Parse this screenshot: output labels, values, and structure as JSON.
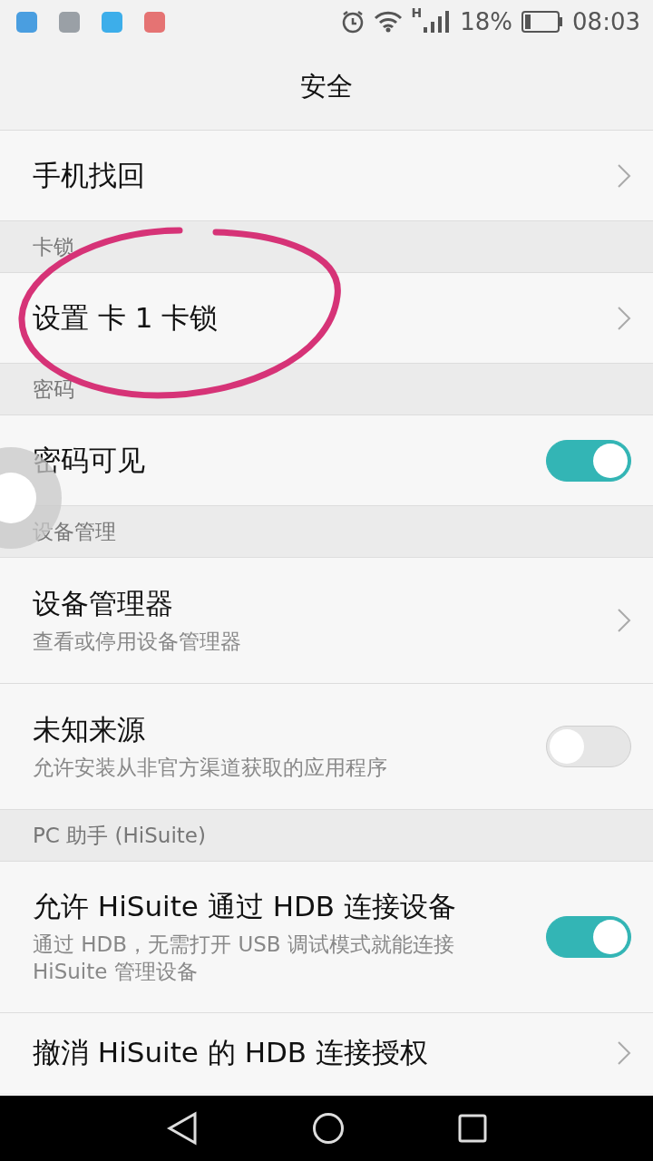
{
  "status_bar": {
    "network_type": "H",
    "battery": "18%",
    "time": "08:03"
  },
  "title": "安全",
  "sections": [
    {
      "items": [
        {
          "kind": "link",
          "title": "手机找回"
        }
      ]
    },
    {
      "header": "卡锁",
      "items": [
        {
          "kind": "link",
          "title": "设置 卡 1 卡锁"
        }
      ]
    },
    {
      "header": "密码",
      "items": [
        {
          "kind": "toggle",
          "title": "密码可见",
          "on": true
        }
      ]
    },
    {
      "header": "设备管理",
      "items": [
        {
          "kind": "link",
          "title": "设备管理器",
          "subtitle": "查看或停用设备管理器"
        },
        {
          "kind": "toggle",
          "title": "未知来源",
          "subtitle": "允许安装从非官方渠道获取的应用程序",
          "on": false
        }
      ]
    },
    {
      "header": "PC 助手 (HiSuite)",
      "items": [
        {
          "kind": "toggle",
          "title": "允许 HiSuite 通过 HDB 连接设备",
          "subtitle": "通过 HDB，无需打开 USB 调试模式就能连接 HiSuite 管理设备",
          "on": true
        },
        {
          "kind": "link",
          "title": "撤消 HiSuite 的 HDB 连接授权"
        }
      ]
    }
  ]
}
